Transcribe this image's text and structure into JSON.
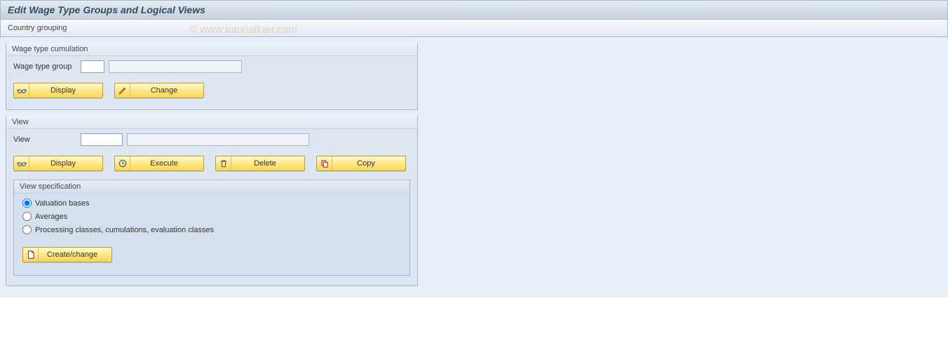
{
  "header": {
    "title": "Edit Wage Type Groups and Logical Views",
    "toolbar_label": "Country grouping"
  },
  "watermark": "© www.tutorialkart.com",
  "group_wage": {
    "title": "Wage type cumulation",
    "field_label": "Wage type group",
    "code_value": "",
    "desc_value": "",
    "btn_display": "Display",
    "btn_change": "Change"
  },
  "group_view": {
    "title": "View",
    "field_label": "View",
    "code_value": "",
    "desc_value": "",
    "btn_display": "Display",
    "btn_execute": "Execute",
    "btn_delete": "Delete",
    "btn_copy": "Copy",
    "spec": {
      "title": "View specification",
      "opt_valuation": "Valuation bases",
      "opt_averages": "Averages",
      "opt_processing": "Processing classes, cumulations, evaluation classes",
      "selected": "valuation",
      "btn_create": "Create/change"
    }
  }
}
